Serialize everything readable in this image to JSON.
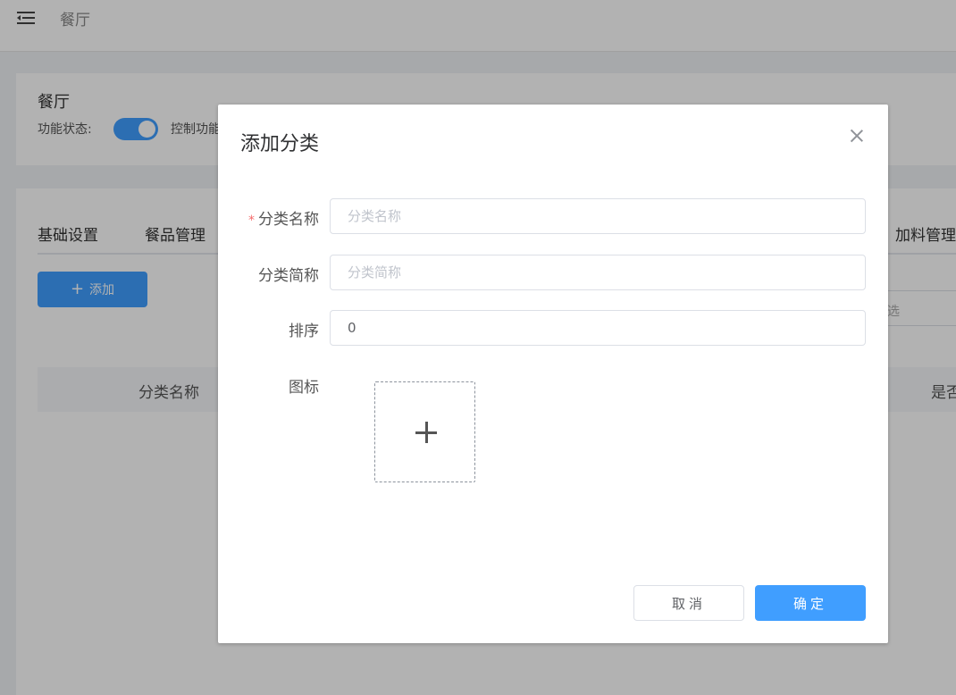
{
  "header": {
    "breadcrumb": "餐厅"
  },
  "restaurant_card": {
    "title": "餐厅",
    "status_label": "功能状态:",
    "status_on": true,
    "description": "控制功能"
  },
  "tabs": [
    "基础设置",
    "餐品管理",
    "加料管理"
  ],
  "toolbar": {
    "add_label": "添加",
    "filter_placeholder": "选"
  },
  "table": {
    "headers": [
      "分类名称",
      "是否"
    ]
  },
  "dialog": {
    "title": "添加分类",
    "fields": {
      "name": {
        "label": "分类名称",
        "required_mark": "*",
        "placeholder": "分类名称",
        "value": ""
      },
      "short_name": {
        "label": "分类简称",
        "placeholder": "分类简称",
        "value": ""
      },
      "sort": {
        "label": "排序",
        "value": "0"
      },
      "icon": {
        "label": "图标"
      }
    },
    "cancel_label": "取消",
    "confirm_label": "确定"
  },
  "colors": {
    "primary": "#409eff",
    "required": "#f56c6c"
  }
}
